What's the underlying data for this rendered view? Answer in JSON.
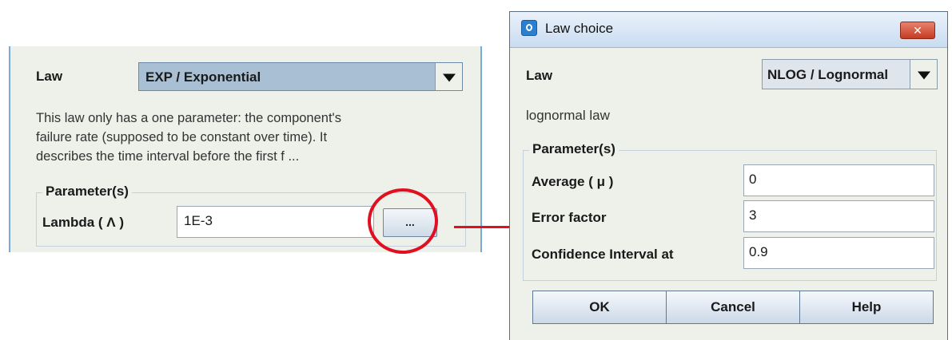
{
  "left_panel": {
    "law_label": "Law",
    "law_selected": "EXP / Exponential",
    "description_lines": [
      "This law only has a one parameter: the component's",
      "failure rate (supposed to be constant over time). It",
      "describes the time interval before the first f ..."
    ],
    "parameters_title": "Parameter(s)",
    "lambda_label": "Lambda ( Λ )",
    "lambda_value": "1E-3",
    "dots_button": "..."
  },
  "dialog": {
    "title": "Law choice",
    "close_label": "✕",
    "law_label": "Law",
    "law_selected": "NLOG / Lognormal",
    "description": "lognormal law",
    "parameters_title": "Parameter(s)",
    "params": [
      {
        "label": "Average ( μ )",
        "value": "0"
      },
      {
        "label": "Error factor",
        "value": "3"
      },
      {
        "label": "Confidence Interval at",
        "value": "0.9"
      }
    ],
    "buttons": {
      "ok": "OK",
      "cancel": "Cancel",
      "help": "Help"
    }
  },
  "colors": {
    "highlight": "#e01020",
    "select_bg": "#a9bfd3"
  }
}
